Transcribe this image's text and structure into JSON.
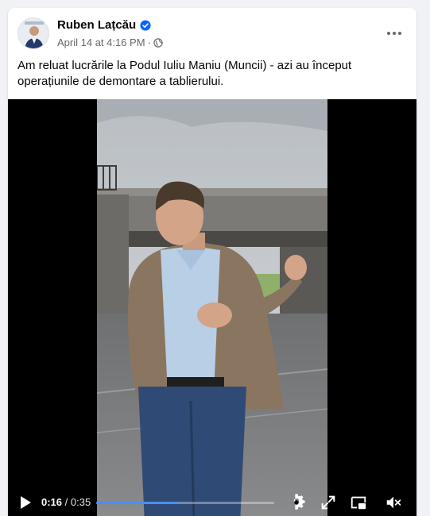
{
  "post": {
    "author": "Ruben Lațcău",
    "date": "April 14 at 4:16 PM",
    "separator": "·",
    "caption": "Am reluat lucrările la Podul Iuliu Maniu (Muncii) - azi au început operațiunile de demontare a tablierului."
  },
  "icons": {
    "verified": "verified-badge-icon",
    "audience": "globe-icon",
    "menu": "more-options-icon"
  },
  "video": {
    "current_time": "0:16",
    "time_separator": " / ",
    "duration": "0:35",
    "progress": 0.457,
    "muted": true
  },
  "colors": {
    "verified_blue": "#0866ff",
    "progress_blue": "#4c8dff",
    "meta_gray": "#65676b"
  }
}
